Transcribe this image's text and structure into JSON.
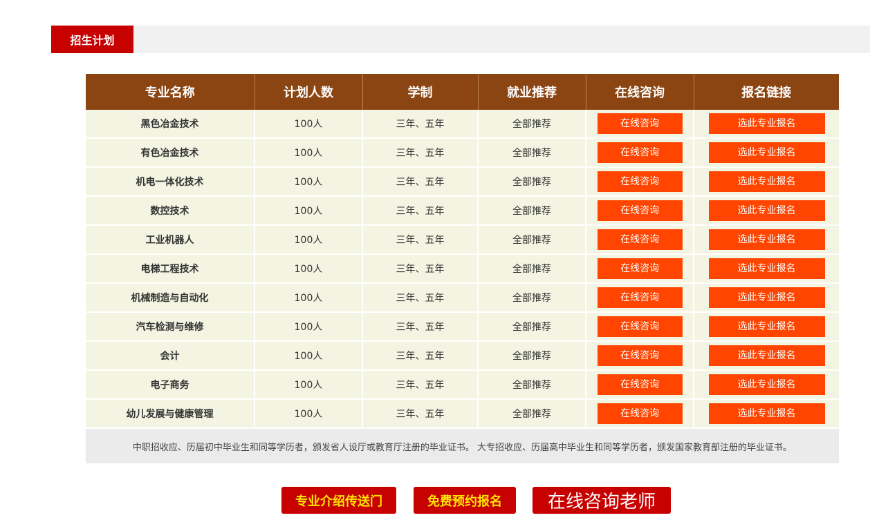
{
  "section": {
    "title": "招生计划"
  },
  "table": {
    "headers": [
      "专业名称",
      "计划人数",
      "学制",
      "就业推荐",
      "在线咨询",
      "报名链接"
    ],
    "rows": [
      {
        "major": "黑色冶金技术",
        "count": "100人",
        "duration": "三年、五年",
        "employment": "全部推荐",
        "consult": "在线咨询",
        "signup": "选此专业报名"
      },
      {
        "major": "有色冶金技术",
        "count": "100人",
        "duration": "三年、五年",
        "employment": "全部推荐",
        "consult": "在线咨询",
        "signup": "选此专业报名"
      },
      {
        "major": "机电一体化技术",
        "count": "100人",
        "duration": "三年、五年",
        "employment": "全部推荐",
        "consult": "在线咨询",
        "signup": "选此专业报名"
      },
      {
        "major": "数控技术",
        "count": "100人",
        "duration": "三年、五年",
        "employment": "全部推荐",
        "consult": "在线咨询",
        "signup": "选此专业报名"
      },
      {
        "major": "工业机器人",
        "count": "100人",
        "duration": "三年、五年",
        "employment": "全部推荐",
        "consult": "在线咨询",
        "signup": "选此专业报名"
      },
      {
        "major": "电梯工程技术",
        "count": "100人",
        "duration": "三年、五年",
        "employment": "全部推荐",
        "consult": "在线咨询",
        "signup": "选此专业报名"
      },
      {
        "major": "机械制造与自动化",
        "count": "100人",
        "duration": "三年、五年",
        "employment": "全部推荐",
        "consult": "在线咨询",
        "signup": "选此专业报名"
      },
      {
        "major": "汽车检测与维修",
        "count": "100人",
        "duration": "三年、五年",
        "employment": "全部推荐",
        "consult": "在线咨询",
        "signup": "选此专业报名"
      },
      {
        "major": "会计",
        "count": "100人",
        "duration": "三年、五年",
        "employment": "全部推荐",
        "consult": "在线咨询",
        "signup": "选此专业报名"
      },
      {
        "major": "电子商务",
        "count": "100人",
        "duration": "三年、五年",
        "employment": "全部推荐",
        "consult": "在线咨询",
        "signup": "选此专业报名"
      },
      {
        "major": "幼儿发展与健康管理",
        "count": "100人",
        "duration": "三年、五年",
        "employment": "全部推荐",
        "consult": "在线咨询",
        "signup": "选此专业报名"
      }
    ]
  },
  "note": "中职招收应、历届初中毕业生和同等学历者，颁发省人设厅或教育厅注册的毕业证书。 大专招收应、历届高中毕业生和同等学历者，颁发国家教育部注册的毕业证书。",
  "bottom": {
    "intro_label": "专业介绍传送门",
    "reserve_label": "免费预约报名",
    "teacher_label": "在线咨询老师"
  },
  "colors": {
    "tab_red": "#c70000",
    "header_brown": "#8b4513",
    "row_bg": "#f4f4e2",
    "button_orange": "#ff4500",
    "yellow_text": "#ffe600"
  }
}
